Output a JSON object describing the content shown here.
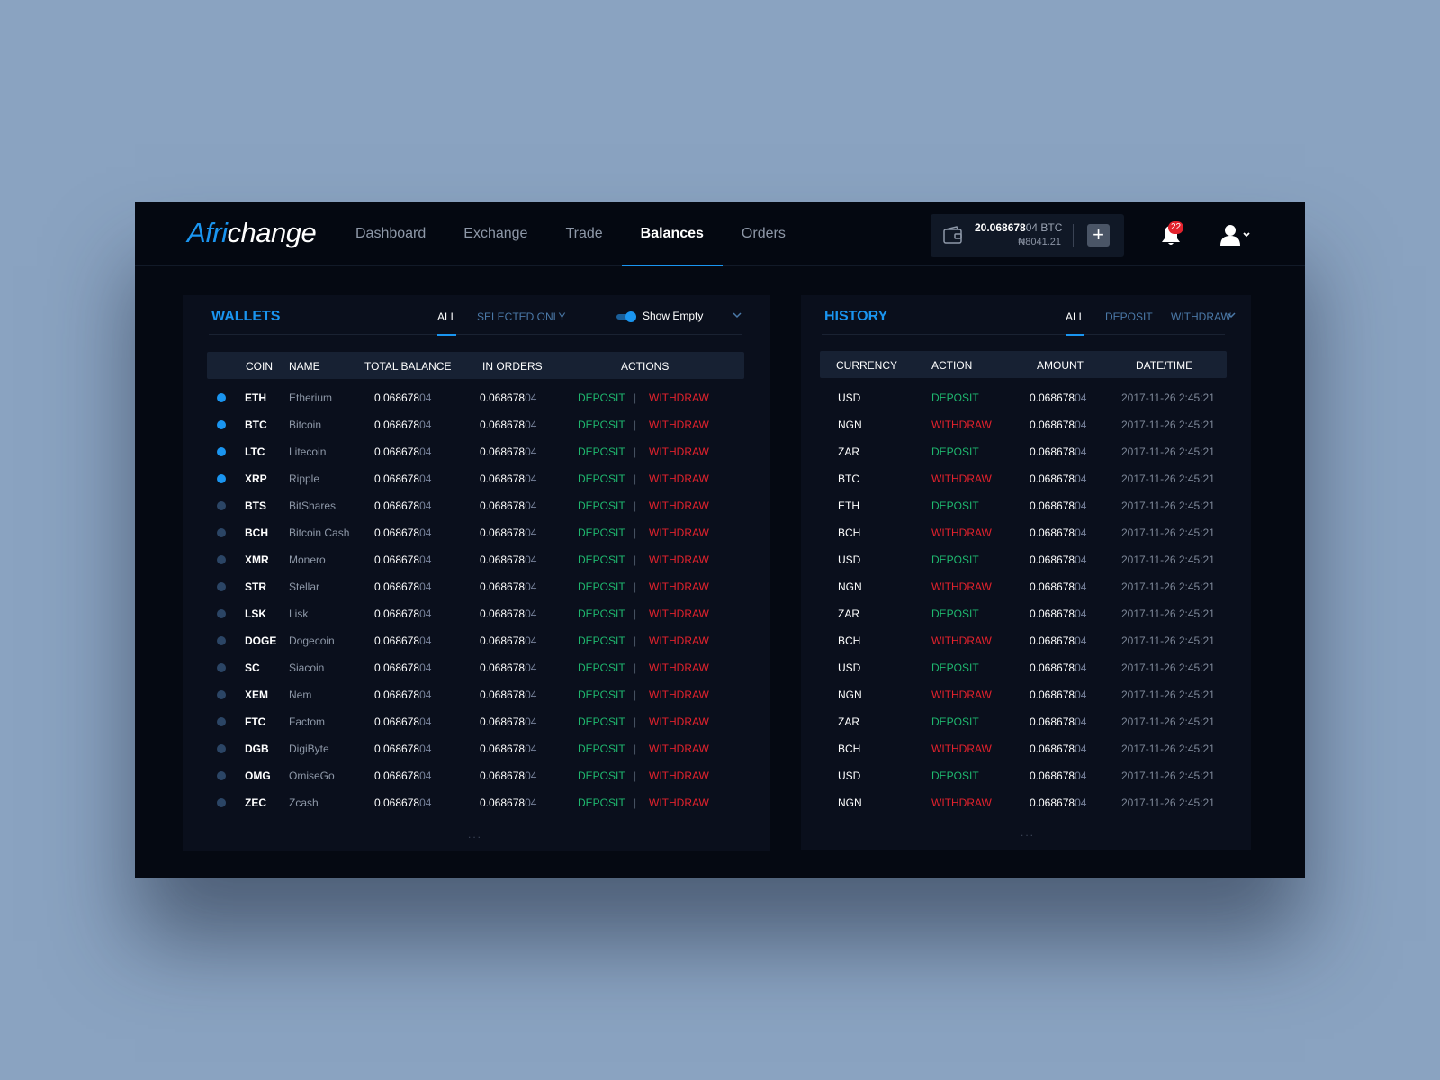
{
  "header": {
    "logo_accent": "Afri",
    "logo_rest": "change",
    "nav": [
      {
        "label": "Dashboard"
      },
      {
        "label": "Exchange"
      },
      {
        "label": "Trade"
      },
      {
        "label": "Balances"
      },
      {
        "label": "Orders"
      }
    ],
    "active_nav": "Balances",
    "wallet": {
      "btc_main": "20.068678",
      "btc_tail": "04 BTC",
      "ngn": "₦8041.21",
      "add_label": "+"
    },
    "notifications_count": "22"
  },
  "wallets": {
    "title": "WALLETS",
    "tabs": [
      "ALL",
      "SELECTED ONLY"
    ],
    "active_tab": "ALL",
    "toggle_label": "Show Empty",
    "toggle_on": true,
    "columns": [
      "COIN",
      "NAME",
      "TOTAL BALANCE",
      "IN ORDERS",
      "ACTIONS"
    ],
    "deposit_label": "DEPOSIT",
    "withdraw_label": "WITHDRAW",
    "separator": "|",
    "rows": [
      {
        "coin": "ETH",
        "name": "Etherium",
        "selected": true
      },
      {
        "coin": "BTC",
        "name": "Bitcoin",
        "selected": true
      },
      {
        "coin": "LTC",
        "name": "Litecoin",
        "selected": true
      },
      {
        "coin": "XRP",
        "name": "Ripple",
        "selected": true
      },
      {
        "coin": "BTS",
        "name": "BitShares",
        "selected": false
      },
      {
        "coin": "BCH",
        "name": "Bitcoin Cash",
        "selected": false
      },
      {
        "coin": "XMR",
        "name": "Monero",
        "selected": false
      },
      {
        "coin": "STR",
        "name": "Stellar",
        "selected": false
      },
      {
        "coin": "LSK",
        "name": "Lisk",
        "selected": false
      },
      {
        "coin": "DOGE",
        "name": "Dogecoin",
        "selected": false
      },
      {
        "coin": "SC",
        "name": "Siacoin",
        "selected": false
      },
      {
        "coin": "XEM",
        "name": "Nem",
        "selected": false
      },
      {
        "coin": "FTC",
        "name": "Factom",
        "selected": false
      },
      {
        "coin": "DGB",
        "name": "DigiByte",
        "selected": false
      },
      {
        "coin": "OMG",
        "name": "OmiseGo",
        "selected": false
      },
      {
        "coin": "ZEC",
        "name": "Zcash",
        "selected": false
      }
    ],
    "balance_main": "0.068678",
    "balance_tail": "04",
    "more": "..."
  },
  "history": {
    "title": "HISTORY",
    "tabs": [
      "ALL",
      "DEPOSIT",
      "WITHDRAW"
    ],
    "active_tab": "ALL",
    "columns": [
      "CURRENCY",
      "ACTION",
      "AMOUNT",
      "DATE/TIME"
    ],
    "rows": [
      {
        "currency": "USD",
        "action": "DEPOSIT"
      },
      {
        "currency": "NGN",
        "action": "WITHDRAW"
      },
      {
        "currency": "ZAR",
        "action": "DEPOSIT"
      },
      {
        "currency": "BTC",
        "action": "WITHDRAW"
      },
      {
        "currency": "ETH",
        "action": "DEPOSIT"
      },
      {
        "currency": "BCH",
        "action": "WITHDRAW"
      },
      {
        "currency": "USD",
        "action": "DEPOSIT"
      },
      {
        "currency": "NGN",
        "action": "WITHDRAW"
      },
      {
        "currency": "ZAR",
        "action": "DEPOSIT"
      },
      {
        "currency": "BCH",
        "action": "WITHDRAW"
      },
      {
        "currency": "USD",
        "action": "DEPOSIT"
      },
      {
        "currency": "NGN",
        "action": "WITHDRAW"
      },
      {
        "currency": "ZAR",
        "action": "DEPOSIT"
      },
      {
        "currency": "BCH",
        "action": "WITHDRAW"
      },
      {
        "currency": "USD",
        "action": "DEPOSIT"
      },
      {
        "currency": "NGN",
        "action": "WITHDRAW"
      }
    ],
    "amount_main": "0.068678",
    "amount_tail": "04",
    "datetime": "2017-11-26 2:45:21",
    "more": "..."
  },
  "colors": {
    "accent": "#1a95f0",
    "deposit": "#1fb86f",
    "withdraw": "#e3222d",
    "background": "#8aa3c1",
    "app_bg": "#050912",
    "panel_bg": "#0a0f1c"
  },
  "icons": [
    "wallet-icon",
    "plus-icon",
    "bell-icon",
    "user-icon",
    "chevron-down-icon"
  ]
}
